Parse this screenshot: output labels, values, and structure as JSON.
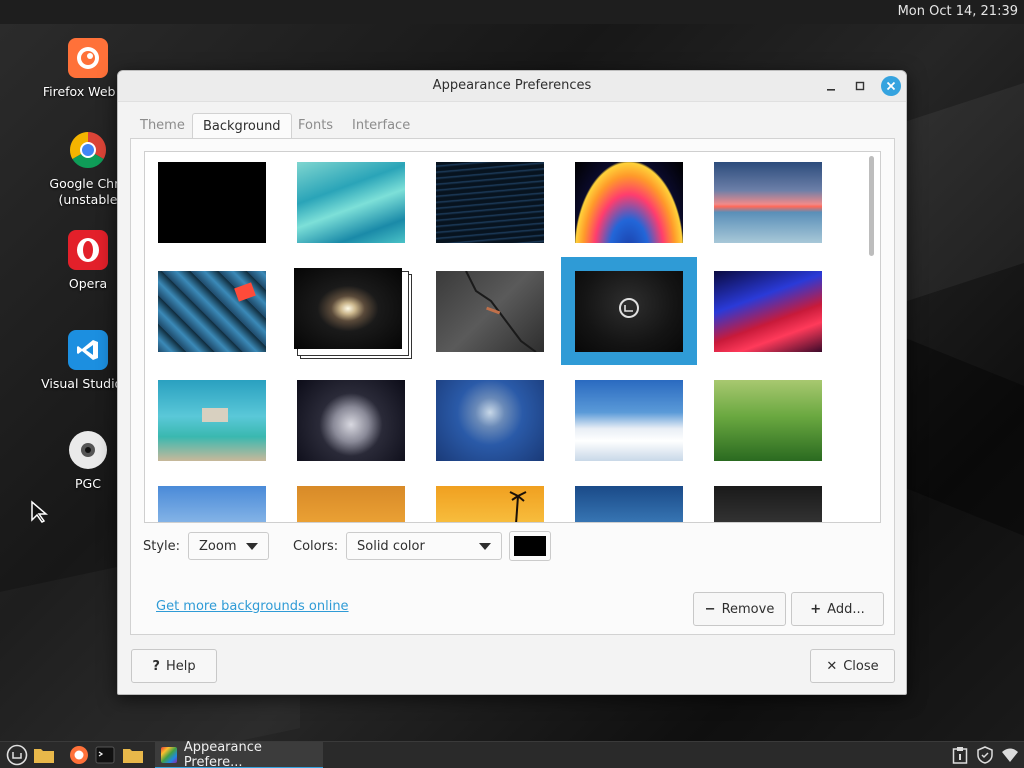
{
  "topbar": {
    "clock": "Mon Oct 14, 21:39"
  },
  "desktop": {
    "icons": [
      {
        "label": "Firefox Web Br",
        "icon": "firefox-icon",
        "color": "#ff7139"
      },
      {
        "label": "Google Chro\n(unstable",
        "icon": "chrome-icon",
        "color": "#db4437"
      },
      {
        "label": "Opera",
        "icon": "opera-icon",
        "color": "#e3202a"
      },
      {
        "label": "Visual Studio C",
        "icon": "vscode-icon",
        "color": "#1c8fe0"
      },
      {
        "label": "PGC",
        "icon": "disc-icon",
        "color": "#e8e8e8"
      }
    ]
  },
  "dialog": {
    "title": "Appearance Preferences",
    "tabs": [
      {
        "label": "Theme",
        "active": false
      },
      {
        "label": "Background",
        "active": true
      },
      {
        "label": "Fonts",
        "active": false
      },
      {
        "label": "Interface",
        "active": false
      }
    ],
    "style_label": "Style:",
    "style_value": "Zoom",
    "colors_label": "Colors:",
    "colors_value": "Solid color",
    "swatch_color": "#000000",
    "more_link": "Get more backgrounds online",
    "remove_label": "Remove",
    "add_label": "Add...",
    "help_label": "Help",
    "close_label": "Close",
    "accent_color": "#2f9bd6",
    "thumbnails": [
      "black solid",
      "teal waves",
      "dark blue lines",
      "colorful swirl",
      "sunset sea",
      "blue cubes",
      "sombrero galaxy",
      "cracked asphalt",
      "mint logo dark",
      "red blue water",
      "submerged ruin",
      "frozen bubble dark",
      "bubble on water",
      "snowy mountains",
      "green grass",
      "blue coastline",
      "orange sky",
      "palm sunset",
      "blue sea horizon",
      "dark gradient"
    ],
    "selected_thumbnail": "mint logo dark"
  },
  "taskbar": {
    "window_label": "Appearance Prefere..."
  }
}
